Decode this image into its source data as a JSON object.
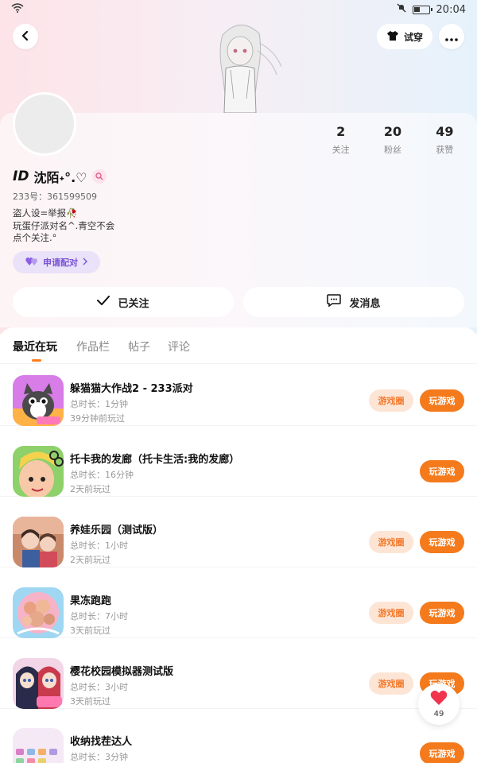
{
  "status_bar": {
    "time": "20:04",
    "wifi_icon": "wifi-icon",
    "mute_icon": "bell-off-icon",
    "battery_icon": "battery-icon"
  },
  "header": {
    "back_icon": "chevron-left-icon",
    "try_on_label": "试穿",
    "try_on_icon": "shirt-icon",
    "more_icon": "more-horizontal-icon"
  },
  "profile": {
    "id_badge": "ID",
    "name": "沈陌˖°.♡",
    "uid": "233号：361599509",
    "bio_lines": [
      "盗人设=举报🥀",
      "玩蛋仔派对名^.青空不会",
      "点个关注.°"
    ],
    "pair_button": "申请配对",
    "stats": [
      {
        "value": "2",
        "label": "关注"
      },
      {
        "value": "20",
        "label": "粉丝"
      },
      {
        "value": "49",
        "label": "获赞"
      }
    ],
    "follow_button": "已关注",
    "message_button": "发消息"
  },
  "tabs": [
    "最近在玩",
    "作品栏",
    "帖子",
    "评论"
  ],
  "active_tab": "最近在玩",
  "games": [
    {
      "title": "躲猫猫大作战2 - 233派对",
      "duration": "总时长：1分钟",
      "last_played": "39分钟前玩过",
      "has_circle": true
    },
    {
      "title": "托卡我的发廊（托卡生活:我的发廊）",
      "duration": "总时长：16分钟",
      "last_played": "2天前玩过",
      "has_circle": false
    },
    {
      "title": "养娃乐园（测试版）",
      "duration": "总时长：1小时",
      "last_played": "2天前玩过",
      "has_circle": true
    },
    {
      "title": "果冻跑跑",
      "duration": "总时长：7小时",
      "last_played": "3天前玩过",
      "has_circle": true
    },
    {
      "title": "樱花校园模拟器测试版",
      "duration": "总时长：3小时",
      "last_played": "3天前玩过",
      "has_circle": true
    },
    {
      "title": "收纳找茬达人",
      "duration": "总时长：3分钟",
      "last_played": "",
      "has_circle": false
    }
  ],
  "game_buttons": {
    "circle": "游戏圈",
    "play": "玩游戏"
  },
  "like_fab": {
    "icon": "heart-icon",
    "count": "49"
  },
  "colors": {
    "accent_orange": "#f47a1c",
    "circle_bg": "#fde5d6",
    "pair_purple": "#7b54d6"
  }
}
